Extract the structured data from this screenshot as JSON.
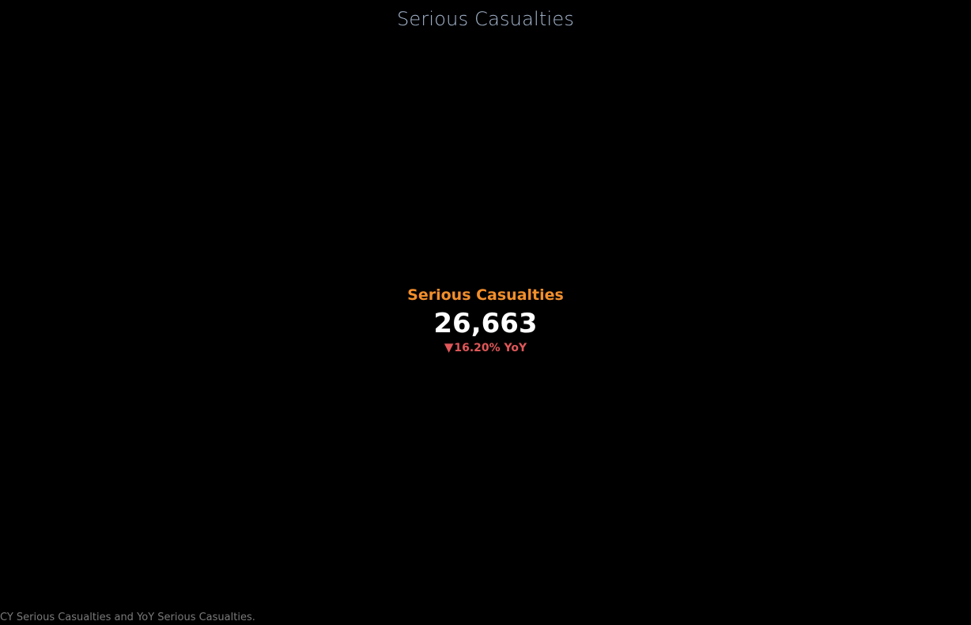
{
  "sheet": {
    "title": "Serious Casualties"
  },
  "kpi": {
    "label": "Serious Casualties",
    "value": "26,663",
    "change_icon": "down-triangle-icon",
    "change_arrow": "▼",
    "change_text": "16.20% YoY",
    "colors": {
      "label": "#f28e2b",
      "value": "#ffffff",
      "change": "#e15759"
    }
  },
  "caption": "CY Serious Casualties and YoY Serious Casualties."
}
